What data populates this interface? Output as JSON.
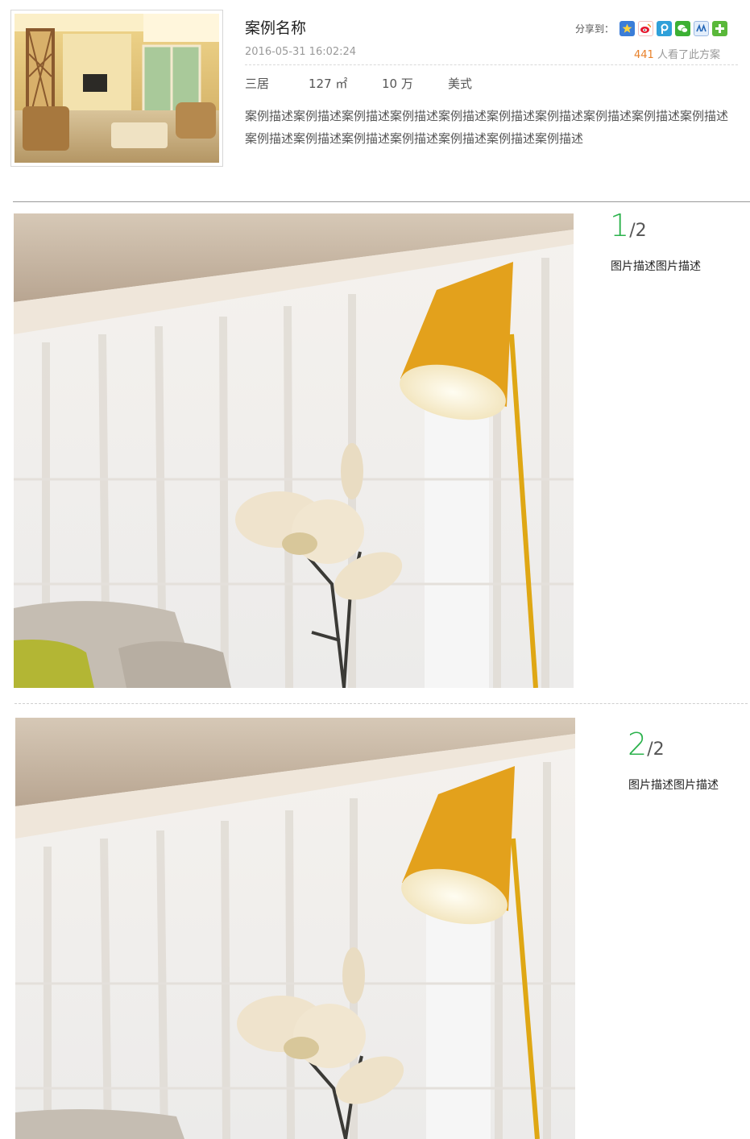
{
  "case": {
    "title": "案例名称",
    "date": "2016-05-31 16:02:24",
    "views_count": "441",
    "views_suffix": "人看了此方案",
    "tags": [
      "三居",
      "127 ㎡",
      "10 万",
      "美式"
    ],
    "description": "案例描述案例描述案例描述案例描述案例描述案例描述案例描述案例描述案例描述案例描述案例描述案例描述案例描述案例描述案例描述案例描述案例描述"
  },
  "share": {
    "label": "分享到：",
    "icons": [
      {
        "name": "qzone-icon",
        "color": "#3b7dd8"
      },
      {
        "name": "weibo-icon",
        "color": "#e6162d"
      },
      {
        "name": "tencent-weibo-icon",
        "color": "#2fa0d9"
      },
      {
        "name": "wechat-icon",
        "color": "#3cb034"
      },
      {
        "name": "renren-icon",
        "color": "#2266b7"
      },
      {
        "name": "more-icon",
        "color": "#5ab83a"
      }
    ]
  },
  "images": [
    {
      "current": "1",
      "total": "/2",
      "caption": "图片描述图片描述"
    },
    {
      "current": "2",
      "total": "/2",
      "caption": "图片描述图片描述"
    }
  ],
  "colors": {
    "accent_green": "#2bb24c",
    "views_orange": "#e8812a",
    "lamp_yellow": "#e3a11c"
  }
}
